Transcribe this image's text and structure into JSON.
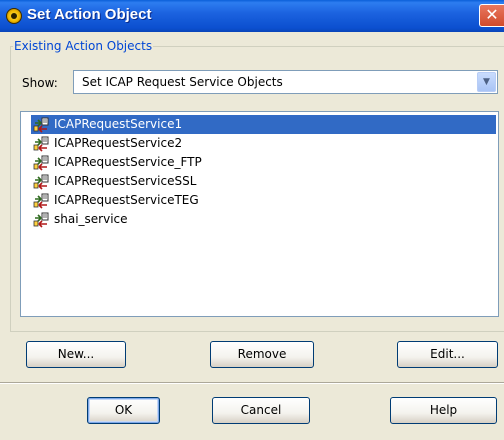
{
  "window": {
    "title": "Set Action Object",
    "close_label": "✕"
  },
  "group": {
    "label": "Existing Action Objects"
  },
  "show": {
    "label": "Show:",
    "selected": "Set ICAP Request Service Objects"
  },
  "list": {
    "items": [
      {
        "label": "ICAPRequestService1",
        "selected": true
      },
      {
        "label": "ICAPRequestService2",
        "selected": false
      },
      {
        "label": "ICAPRequestService_FTP",
        "selected": false
      },
      {
        "label": "ICAPRequestServiceSSL",
        "selected": false
      },
      {
        "label": "ICAPRequestServiceTEG",
        "selected": false
      },
      {
        "label": "shai_service",
        "selected": false
      }
    ],
    "item_icon": "service-object-icon"
  },
  "actions": {
    "new_label": "New...",
    "remove_label": "Remove",
    "edit_label": "Edit..."
  },
  "dialog": {
    "ok_label": "OK",
    "cancel_label": "Cancel",
    "help_label": "Help"
  },
  "colors": {
    "title_bar": "#0b4fcf",
    "selection": "#316ac5",
    "group_label": "#0046d5",
    "background": "#ece9d8"
  }
}
